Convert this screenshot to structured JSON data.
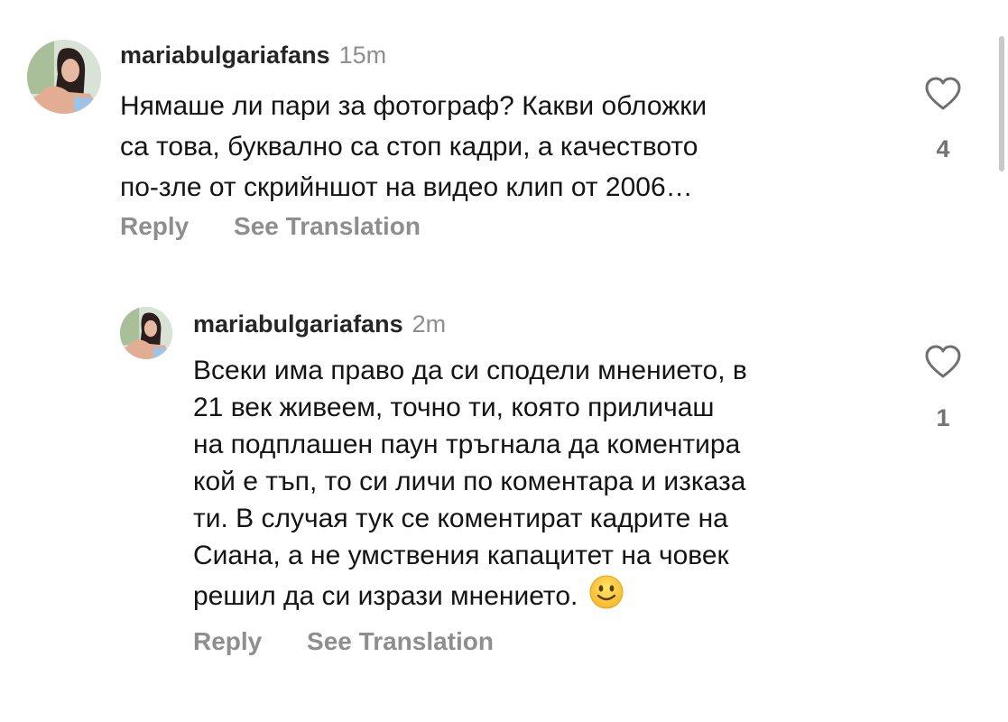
{
  "comments": [
    {
      "username": "mariabulgariafans",
      "time": "15m",
      "lines": [
        "Нямаше ли пари за фотограф? Какви обложки",
        "са това, буквално са стоп кадри, а качеството",
        "по-зле от скрийншот на видео клип от 2006…"
      ],
      "reply_label": "Reply",
      "translate_label": "See Translation",
      "like_count": "4",
      "heart_icon": "heart-outline-icon"
    },
    {
      "username": "mariabulgariafans",
      "time": "2m",
      "lines": [
        "Всеки има право да си сподели мнението, в",
        "21 век живеем, точно ти, която приличаш",
        "на подплашен паун тръгнала да коментира",
        "кой е тъп, то си личи по коментара и изказа",
        "ти. В случая тук се коментират кадрите на",
        "Сиана, а не умствения капацитет на човек",
        "решил да си изрази мнението."
      ],
      "emoji": "slightly-smiling-face-emoji",
      "reply_label": "Reply",
      "translate_label": "See Translation",
      "like_count": "1",
      "heart_icon": "heart-outline-icon"
    }
  ]
}
